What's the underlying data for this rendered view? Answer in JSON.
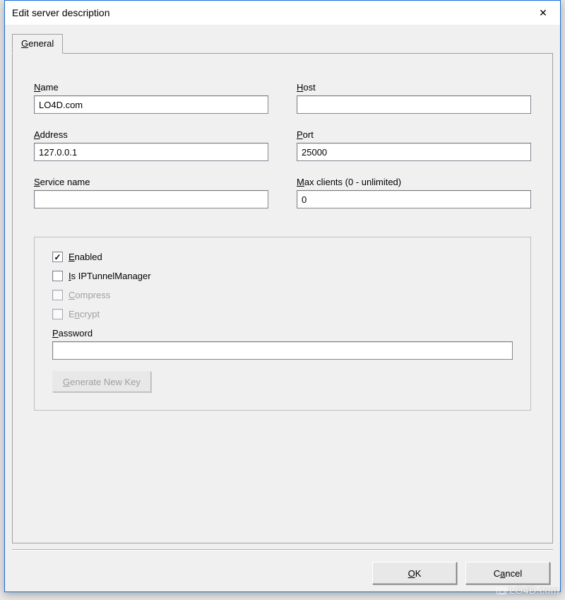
{
  "window": {
    "title": "Edit server description",
    "close_glyph": "✕"
  },
  "tabs": {
    "general": {
      "prefix": "G",
      "rest": "eneral"
    }
  },
  "fields": {
    "name": {
      "u": "N",
      "rest": "ame",
      "value": "LO4D.com"
    },
    "host": {
      "u": "H",
      "rest": "ost",
      "value": ""
    },
    "address": {
      "u": "A",
      "rest": "ddress",
      "value": "127.0.0.1"
    },
    "port": {
      "u": "P",
      "rest": "ort",
      "value": "25000"
    },
    "service": {
      "u": "S",
      "rest": "ervice name",
      "value": ""
    },
    "maxclients": {
      "u": "M",
      "rest": "ax clients (0 - unlimited)",
      "value": "0"
    }
  },
  "options": {
    "enabled": {
      "u": "E",
      "rest": "nabled",
      "checked": true,
      "disabled": false
    },
    "istunnel": {
      "u": "I",
      "rest": "s IPTunnelManager",
      "checked": false,
      "disabled": false
    },
    "compress": {
      "u": "C",
      "rest": "ompress",
      "checked": false,
      "disabled": true
    },
    "encrypt": {
      "pre": "E",
      "u": "n",
      "rest": "crypt",
      "checked": false,
      "disabled": true
    }
  },
  "password": {
    "u": "P",
    "rest": "assword",
    "value": ""
  },
  "genkey": {
    "u": "G",
    "rest": "enerate New Key"
  },
  "buttons": {
    "ok": {
      "u": "O",
      "rest": "K"
    },
    "cancel": {
      "pre": "C",
      "u": "a",
      "rest": "ncel"
    }
  },
  "watermark": "LO4D.com"
}
